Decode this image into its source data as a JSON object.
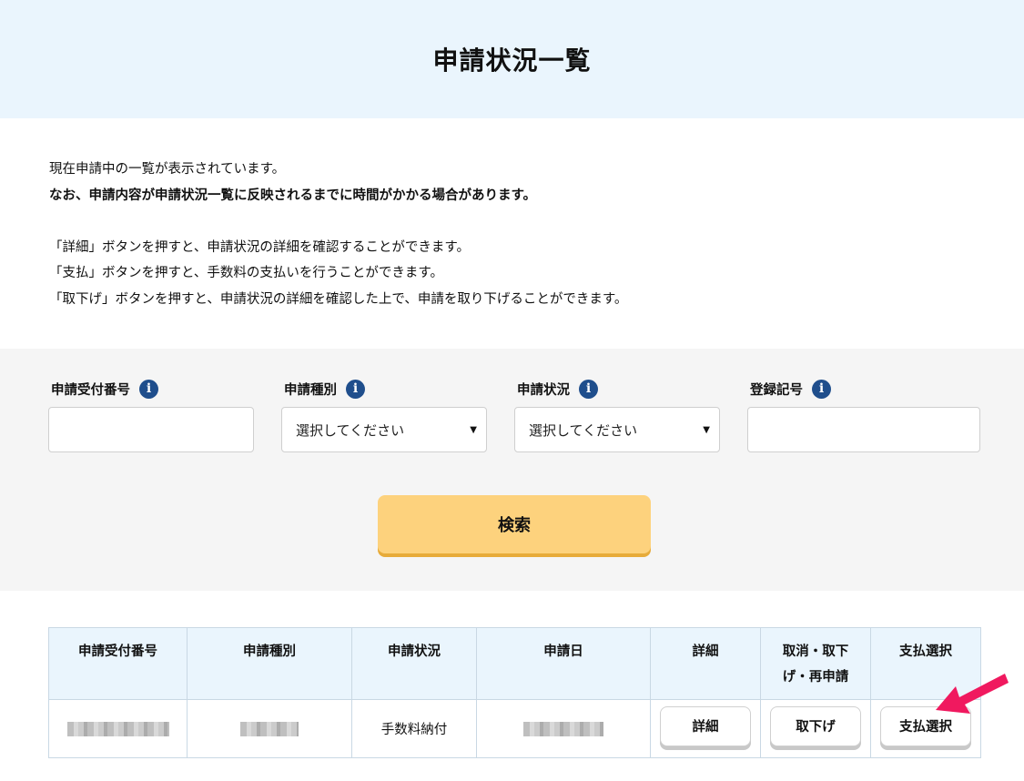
{
  "page": {
    "title": "申請状況一覧"
  },
  "description": {
    "line1": "現在申請中の一覧が表示されています。",
    "line2": "なお、申請内容が申請状況一覧に反映されるまでに時間がかかる場合があります。",
    "line3": "「詳細」ボタンを押すと、申請状況の詳細を確認することができます。",
    "line4": "「支払」ボタンを押すと、手数料の支払いを行うことができます。",
    "line5": "「取下げ」ボタンを押すと、申請状況の詳細を確認した上で、申請を取り下げることができます。"
  },
  "search": {
    "receipt_number": {
      "label": "申請受付番号",
      "value": "",
      "info_icon": "i"
    },
    "application_type": {
      "label": "申請種別",
      "value": "選択してください",
      "info_icon": "i"
    },
    "application_status": {
      "label": "申請状況",
      "value": "選択してください",
      "info_icon": "i"
    },
    "registration_mark": {
      "label": "登録記号",
      "value": "",
      "info_icon": "i"
    },
    "button_label": "検索",
    "caret": "▼"
  },
  "table": {
    "headers": {
      "receipt_number": "申請受付番号",
      "type": "申請種別",
      "status": "申請状況",
      "date": "申請日",
      "detail": "詳細",
      "cancel_line1": "取消・取下",
      "cancel_line2": "げ・再申請",
      "payment": "支払選択"
    },
    "rows": [
      {
        "receipt_number": "(redacted)",
        "type": "(redacted)",
        "status": "手数料納付",
        "date": "(redacted)",
        "detail_button": "詳細",
        "withdraw_button": "取下げ",
        "payment_button": "支払選択"
      }
    ]
  },
  "annotation": {
    "arrow_color": "#f0195f"
  },
  "colors": {
    "header_bg": "#eaf5fd",
    "search_bg": "#f5f5f5",
    "search_button": "#fdd27d",
    "info_icon": "#1f4e8c"
  }
}
